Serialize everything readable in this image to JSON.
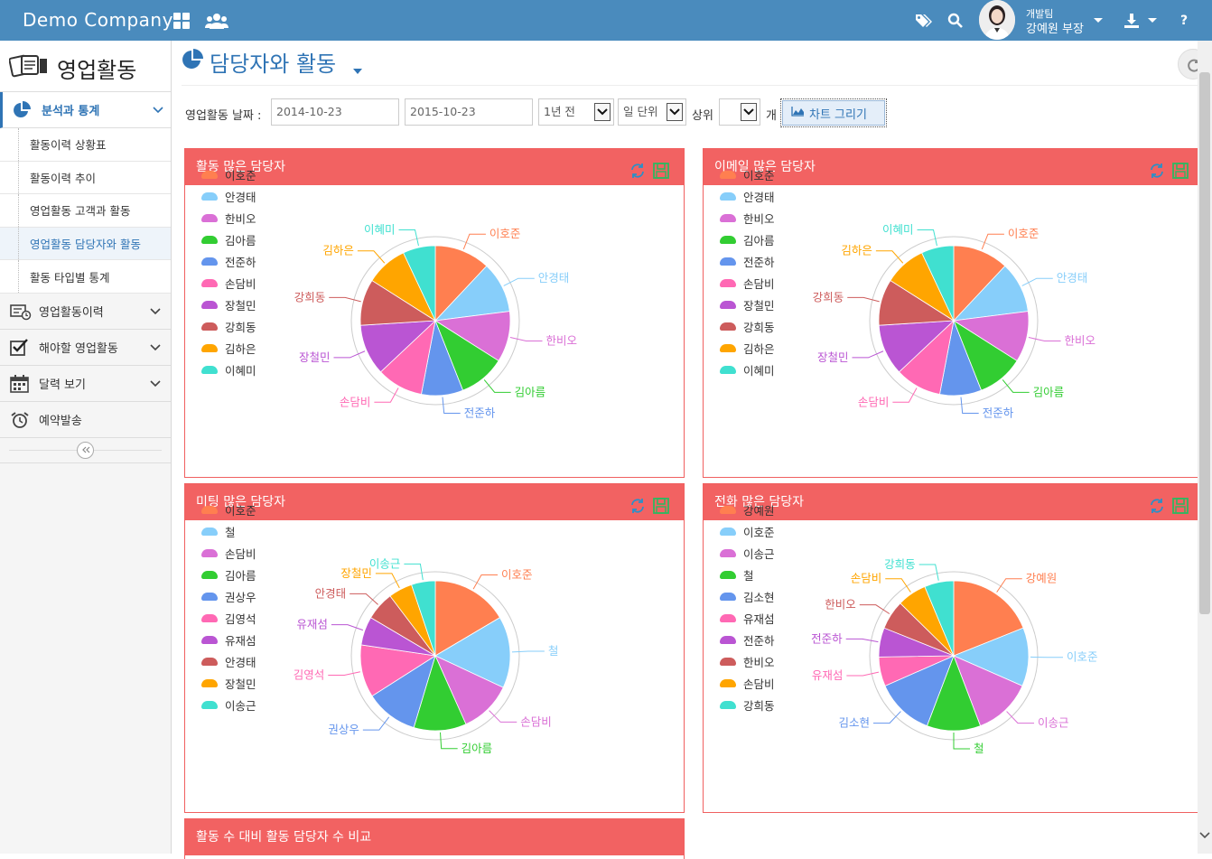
{
  "topbar": {
    "brand": "Demo Company",
    "user_team": "개발팀",
    "user_name": "강예원 부장",
    "help": "?"
  },
  "sidebar": {
    "title": "영업활동",
    "sections": [
      {
        "label": "분석과 통계",
        "active": true
      },
      {
        "label": "영업활동이력"
      },
      {
        "label": "해야할 영업활동"
      },
      {
        "label": "달력 보기"
      },
      {
        "label": "예약발송"
      }
    ],
    "sub_items": [
      "활동이력 상황표",
      "활동이력 추이",
      "영업활동 고객과 활동",
      "영업활동 담당자와 활동",
      "활동 타입별 통계"
    ],
    "selected_sub": 3
  },
  "main": {
    "title": "담당자와 활동",
    "filter": {
      "date_label": "영업활동 날짜 :",
      "date_from": "2014-10-23",
      "date_to": "2015-10-23",
      "period": "1년 전",
      "unit": "일 단위",
      "top_label": "상위",
      "top_value": "",
      "count_suffix": "개",
      "draw_button": "차트 그리기"
    },
    "bottom_panel_title": "활동 수 대비 활동 담당자 수 비교"
  },
  "colors": {
    "header": "#4a8bbd",
    "accent": "#2f74b5",
    "panel": "#f26262"
  },
  "chart_data": [
    {
      "type": "pie",
      "title": "활동 많은 담당자",
      "series": [
        {
          "values": [
            12,
            11,
            11,
            10,
            9,
            10,
            11,
            10,
            9,
            7
          ]
        }
      ],
      "categories": [
        "이호준",
        "안경태",
        "한비오",
        "김아름",
        "전준하",
        "손담비",
        "장철민",
        "강희동",
        "김하은",
        "이혜미"
      ],
      "colors": [
        "#ff7f50",
        "#87cefa",
        "#da70d6",
        "#32cd32",
        "#6495ed",
        "#ff69b4",
        "#ba55d3",
        "#cd5c5c",
        "#ffa500",
        "#40e0d0"
      ]
    },
    {
      "type": "pie",
      "title": "이메일 많은 담당자",
      "series": [
        {
          "values": [
            12,
            11,
            11,
            10,
            9,
            10,
            11,
            10,
            9,
            7
          ]
        }
      ],
      "categories": [
        "이호준",
        "안경태",
        "한비오",
        "김아름",
        "전준하",
        "손담비",
        "장철민",
        "강희동",
        "김하은",
        "이혜미"
      ],
      "colors": [
        "#ff7f50",
        "#87cefa",
        "#da70d6",
        "#32cd32",
        "#6495ed",
        "#ff69b4",
        "#ba55d3",
        "#cd5c5c",
        "#ffa500",
        "#40e0d0"
      ]
    },
    {
      "type": "pie",
      "title": "미팅 많은 담당자",
      "series": [
        {
          "values": [
            16,
            15,
            11,
            11,
            11,
            11,
            6,
            6,
            5,
            5
          ]
        }
      ],
      "categories": [
        "이호준",
        "철",
        "손담비",
        "김아름",
        "권상우",
        "김영석",
        "유재섬",
        "안경태",
        "장철민",
        "이송근"
      ],
      "colors": [
        "#ff7f50",
        "#87cefa",
        "#da70d6",
        "#32cd32",
        "#6495ed",
        "#ff69b4",
        "#ba55d3",
        "#cd5c5c",
        "#ffa500",
        "#40e0d0"
      ]
    },
    {
      "type": "pie",
      "title": "전화 많은 담당자",
      "series": [
        {
          "values": [
            18,
            12,
            12,
            11,
            12,
            6,
            6,
            6,
            6,
            6
          ]
        }
      ],
      "categories": [
        "강예원",
        "이호준",
        "이송근",
        "철",
        "김소현",
        "유재섬",
        "전준하",
        "한비오",
        "손담비",
        "강희동"
      ],
      "colors": [
        "#ff7f50",
        "#87cefa",
        "#da70d6",
        "#32cd32",
        "#6495ed",
        "#ff69b4",
        "#ba55d3",
        "#cd5c5c",
        "#ffa500",
        "#40e0d0"
      ]
    }
  ]
}
